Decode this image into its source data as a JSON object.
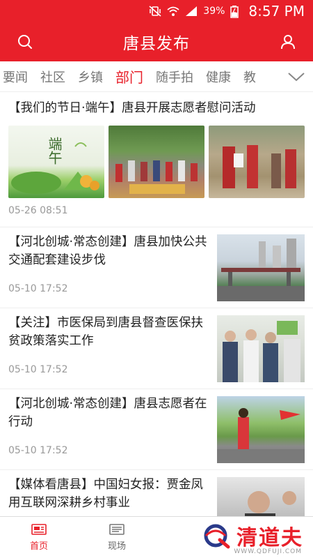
{
  "status_bar": {
    "battery": "39%",
    "time": "8:57 PM"
  },
  "app_bar": {
    "title": "唐县发布",
    "left_icon": "search-icon",
    "right_icon": "user-icon"
  },
  "tabs": [
    {
      "label": "要闻",
      "active": false
    },
    {
      "label": "社区",
      "active": false
    },
    {
      "label": "乡镇",
      "active": false
    },
    {
      "label": "部门",
      "active": true
    },
    {
      "label": "随手拍",
      "active": false
    },
    {
      "label": "健康",
      "active": false
    },
    {
      "label": "教",
      "active": false
    }
  ],
  "feed": {
    "featured": {
      "title": "【我们的节日·端午】唐县开展志愿者慰问活动",
      "image1_text": "端午",
      "time": "05-26 08:51"
    },
    "items": [
      {
        "title": "【河北创城·常态创建】唐县加快公共交通配套建设步伐",
        "time": "05-10 17:52"
      },
      {
        "title": "【关注】市医保局到唐县督查医保扶贫政策落实工作",
        "time": "05-10 17:52"
      },
      {
        "title": "【河北创城·常态创建】唐县志愿者在行动",
        "time": "05-10 17:52"
      },
      {
        "title": "【媒体看唐县】中国妇女报：贾金凤用互联网深耕乡村事业",
        "time": ""
      }
    ]
  },
  "bottom_nav": [
    {
      "label": "首页",
      "icon": "home-icon",
      "active": true
    },
    {
      "label": "现场",
      "icon": "live-icon",
      "active": false
    }
  ],
  "watermark": {
    "text": "清道夫",
    "url": "WWW.QDFUJI.COM"
  },
  "colors": {
    "brand_red": "#e8202a"
  }
}
